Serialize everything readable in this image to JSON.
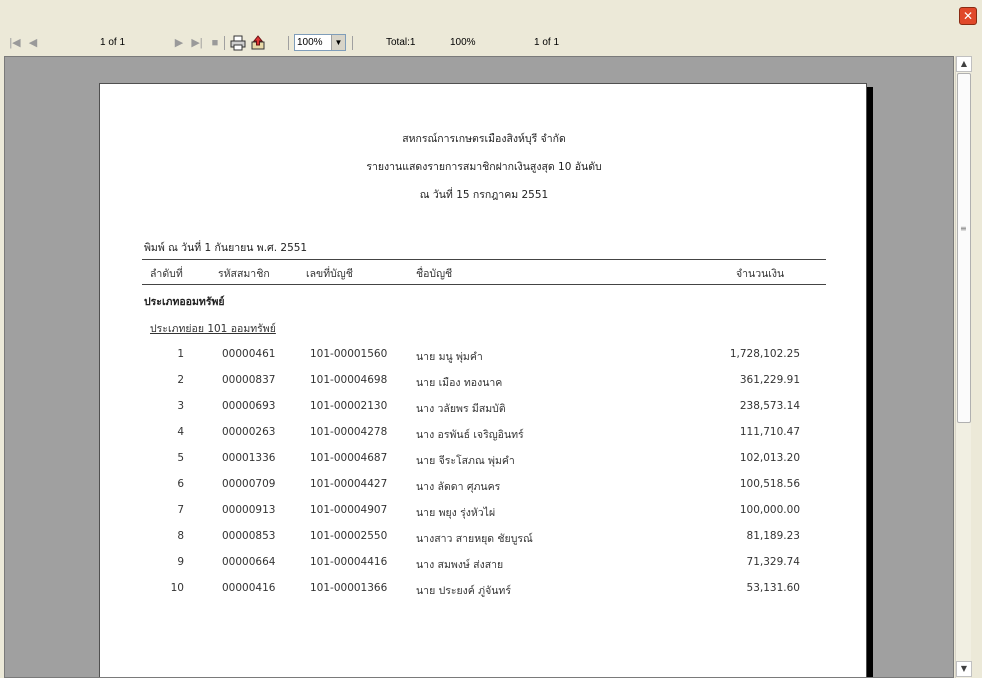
{
  "toolbar": {
    "page_indicator": "1 of 1",
    "zoom_value": "100%",
    "total_label": "Total:1",
    "zoom_status": "100%",
    "page_status": "1 of 1"
  },
  "report": {
    "org_name": "สหกรณ์การเกษตรเมืองสิงห์บุรี จำกัด",
    "title": "รายงานแสดงรายการสมาชิกฝากเงินสูงสุด 10 อันดับ",
    "as_of": "ณ วันที่ 15 กรกฎาคม  2551",
    "print_date": "พิมพ์ ณ วันที่ 1 กันยายน พ.ศ. 2551",
    "columns": [
      "ลำดับที่",
      "รหัสสมาชิก",
      "เลขที่บัญชี",
      "ชื่อบัญชี",
      "จำนวนเงิน"
    ],
    "category": "ประเภทออมทรัพย์",
    "subcategory": "ประเภทย่อย  101 ออมทรัพย์",
    "rows": [
      {
        "no": "1",
        "member_id": "00000461",
        "account": "101-00001560",
        "name": "นาย มนู พุ่มคำ",
        "amount": "1,728,102.25"
      },
      {
        "no": "2",
        "member_id": "00000837",
        "account": "101-00004698",
        "name": "นาย เมือง ทองนาค",
        "amount": "361,229.91"
      },
      {
        "no": "3",
        "member_id": "00000693",
        "account": "101-00002130",
        "name": "นาง วลัยพร มีสมบัติ",
        "amount": "238,573.14"
      },
      {
        "no": "4",
        "member_id": "00000263",
        "account": "101-00004278",
        "name": "นาง อรพันธ์ เจริญอินทร์",
        "amount": "111,710.47"
      },
      {
        "no": "5",
        "member_id": "00001336",
        "account": "101-00004687",
        "name": "นาย จีระโสภณ พุ่มคำ",
        "amount": "102,013.20"
      },
      {
        "no": "6",
        "member_id": "00000709",
        "account": "101-00004427",
        "name": "นาง ลัดดา ศุภนคร",
        "amount": "100,518.56"
      },
      {
        "no": "7",
        "member_id": "00000913",
        "account": "101-00004907",
        "name": "นาย พยุง รุ่งหัวไผ่",
        "amount": "100,000.00"
      },
      {
        "no": "8",
        "member_id": "00000853",
        "account": "101-00002550",
        "name": "นางสาว สายหยุด ชัยบูรณ์",
        "amount": "81,189.23"
      },
      {
        "no": "9",
        "member_id": "00000664",
        "account": "101-00004416",
        "name": "นาง สมพงษ์ ส่งสาย",
        "amount": "71,329.74"
      },
      {
        "no": "10",
        "member_id": "00000416",
        "account": "101-00001366",
        "name": "นาย ประยงค์ ภู่จันทร์",
        "amount": "53,131.60"
      }
    ]
  },
  "colors": {
    "window_bg": "#ece9d8",
    "viewer_bg": "#a0a0a0",
    "page_bg": "#ffffff",
    "close_button": "#e0482a"
  },
  "icons": [
    "first-page-icon",
    "prev-page-icon",
    "next-page-icon",
    "last-page-icon",
    "stop-icon",
    "print-icon",
    "export-icon",
    "close-icon"
  ]
}
